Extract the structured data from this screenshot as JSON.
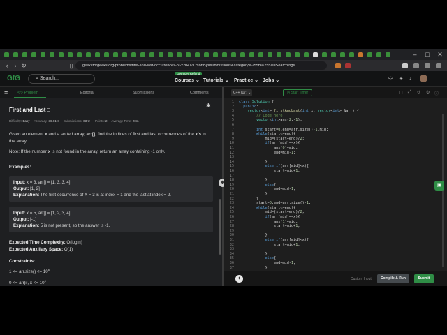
{
  "browser": {
    "url": "geeksforgeeks.org/problems/first-and-last-occurrences-of-x2041/1?sortBy=submissions&category%255B%255D=Searching&...",
    "window_controls": [
      "–",
      "□",
      "✕"
    ]
  },
  "site": {
    "logo": "GfG",
    "search_placeholder": "Search...",
    "promo": "Get 90% Refund",
    "menu": [
      "Courses ⌄",
      "Tutorials ⌄",
      "Practice ⌄",
      "Jobs ⌄"
    ]
  },
  "left_tabs": {
    "problem": "</> Problem",
    "editorial": "Editorial",
    "submissions": "Submissions",
    "comments": "Comments"
  },
  "problem": {
    "title": "First and Last",
    "meta": {
      "difficulty_label": "Difficulty:",
      "difficulty": "Easy",
      "accuracy_label": "Accuracy:",
      "accuracy": "36.61%",
      "submissions_label": "Submissions:",
      "submissions": "63K+",
      "points_label": "Points:",
      "points": "2",
      "time_label": "Average Time:",
      "time": "20m"
    },
    "statement_1": "Given an element ",
    "statement_x": "x",
    "statement_2": " and a sorted array, ",
    "statement_arr": "arr[]",
    "statement_3": ", find the indices of first and last occurrences of the ",
    "statement_xs": "x's",
    "statement_4": " in the array.",
    "note_1": "Note: If the number ",
    "note_x": "x",
    "note_2": " is not found in the array, return an array containing -1 only.",
    "examples_label": "Examples:",
    "example1": {
      "input_label": "Input:",
      "input": " x = 3, arr[] = [1, 3, 3, 4]",
      "output_label": "Output:",
      "output": " [1, 2]",
      "expl_label": "Explanation:",
      "expl": " The first occurrence of X = 3 is at index = 1 and the last at index = 2."
    },
    "example2": {
      "input_label": "Input:",
      "input": " x = 5, arr[] = [1, 2, 3, 4]",
      "output_label": "Output:",
      "output": " [-1]",
      "expl_label": "Explanation:",
      "expl": " 5 is not present, so the answer is -1."
    },
    "time_complexity_label": "Expected Time Complexity:",
    "time_complexity": " O(log n)",
    "aux_space_label": "Expected Auxiliary Space:",
    "aux_space": " O(1)",
    "constraints_label": "Constraints:",
    "constraint1": "1 <= arr.size() <= 10",
    "constraint1_exp": "6",
    "constraint2": "0 <= arr[i], x <= 10",
    "constraint2_exp": "9"
  },
  "editor": {
    "language": "C++ (17)",
    "timer": "Start Timer",
    "line_numbers": [
      "1",
      "2",
      "3",
      "4",
      "5",
      "6",
      "7",
      "8",
      "9",
      "10",
      "11",
      "12",
      "13",
      "14",
      "15",
      "16",
      "17",
      "18",
      "19",
      "20",
      "21",
      "22",
      "23",
      "24",
      "25",
      "26",
      "27",
      "28",
      "29",
      "30",
      "31",
      "32",
      "33",
      "34",
      "35",
      "36",
      "37"
    ],
    "custom_input": "Custom Input",
    "compile_run": "Compile & Run",
    "submit": "Submit"
  }
}
